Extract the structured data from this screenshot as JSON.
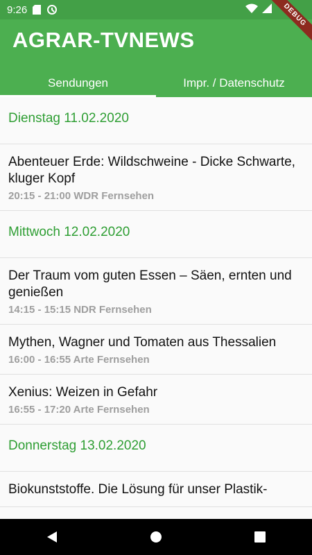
{
  "status_bar": {
    "time": "9:26"
  },
  "app": {
    "title": "AGRAR-TVNEWS",
    "debug_label": "DEBUG"
  },
  "tabs": [
    {
      "label": "Sendungen",
      "active": true
    },
    {
      "label": "Impr. / Datenschutz",
      "active": false
    }
  ],
  "schedule": [
    {
      "date": "Dienstag 11.02.2020",
      "shows": [
        {
          "title": "Abenteuer Erde: Wildschweine - Dicke Schwarte, kluger Kopf",
          "info": "20:15 - 21:00 WDR Fernsehen"
        }
      ]
    },
    {
      "date": "Mittwoch 12.02.2020",
      "shows": [
        {
          "title": "Der Traum vom guten Essen – Säen, ernten und genießen",
          "info": "14:15 - 15:15 NDR Fernsehen"
        },
        {
          "title": "Mythen, Wagner und Tomaten aus Thessalien",
          "info": "16:00 - 16:55 Arte Fernsehen"
        },
        {
          "title": "Xenius: Weizen in Gefahr",
          "info": "16:55 - 17:20 Arte Fernsehen"
        }
      ]
    },
    {
      "date": "Donnerstag 13.02.2020",
      "shows": [
        {
          "title": "Biokunststoffe. Die Lösung für unser Plastik-",
          "info": ""
        }
      ]
    }
  ],
  "colors": {
    "primary": "#4caf50",
    "status_bar": "#43a047",
    "accent_text": "#2e9e33"
  },
  "nav_icons": [
    "back-icon",
    "home-icon",
    "recents-icon"
  ]
}
